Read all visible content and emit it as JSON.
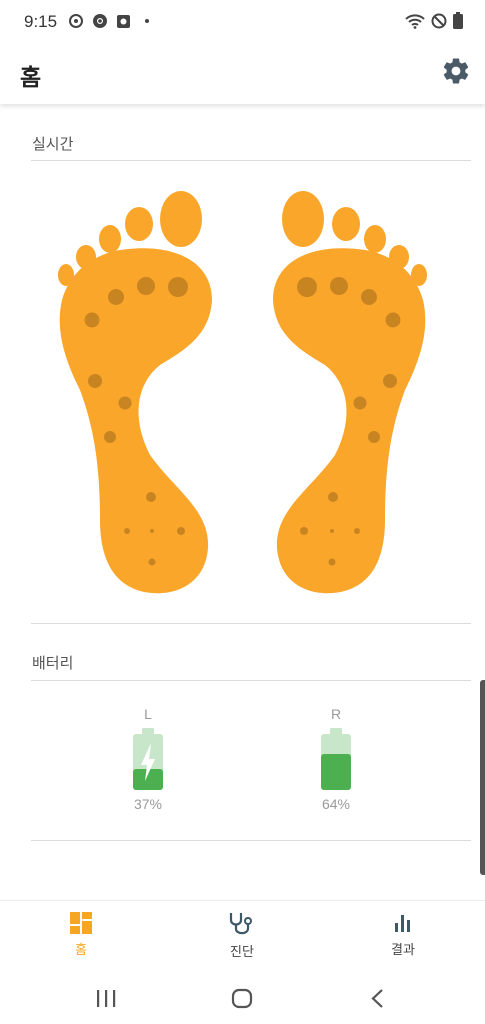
{
  "status_bar": {
    "time": "9:15"
  },
  "app_bar": {
    "title": "홈",
    "settings_icon": "gear-icon"
  },
  "realtime": {
    "title": "실시간",
    "foot_color": "#F9A62B",
    "sensor_color": "#C98422"
  },
  "battery": {
    "title": "배터리",
    "left": {
      "label": "L",
      "percent_text": "37%",
      "level": 0.37,
      "charging": true
    },
    "right": {
      "label": "R",
      "percent_text": "64%",
      "level": 0.64,
      "charging": false
    },
    "fill_color": "#4CAF50",
    "empty_color": "#C8E6C9"
  },
  "bottom_nav": {
    "items": [
      {
        "label": "홈",
        "icon": "dashboard-icon",
        "active": true
      },
      {
        "label": "진단",
        "icon": "stethoscope-icon",
        "active": false
      },
      {
        "label": "결과",
        "icon": "bar-chart-icon",
        "active": false
      }
    ],
    "active_color": "#F5A623"
  },
  "system_nav": {
    "recents": "recents-icon",
    "home": "home-icon",
    "back": "back-icon"
  }
}
